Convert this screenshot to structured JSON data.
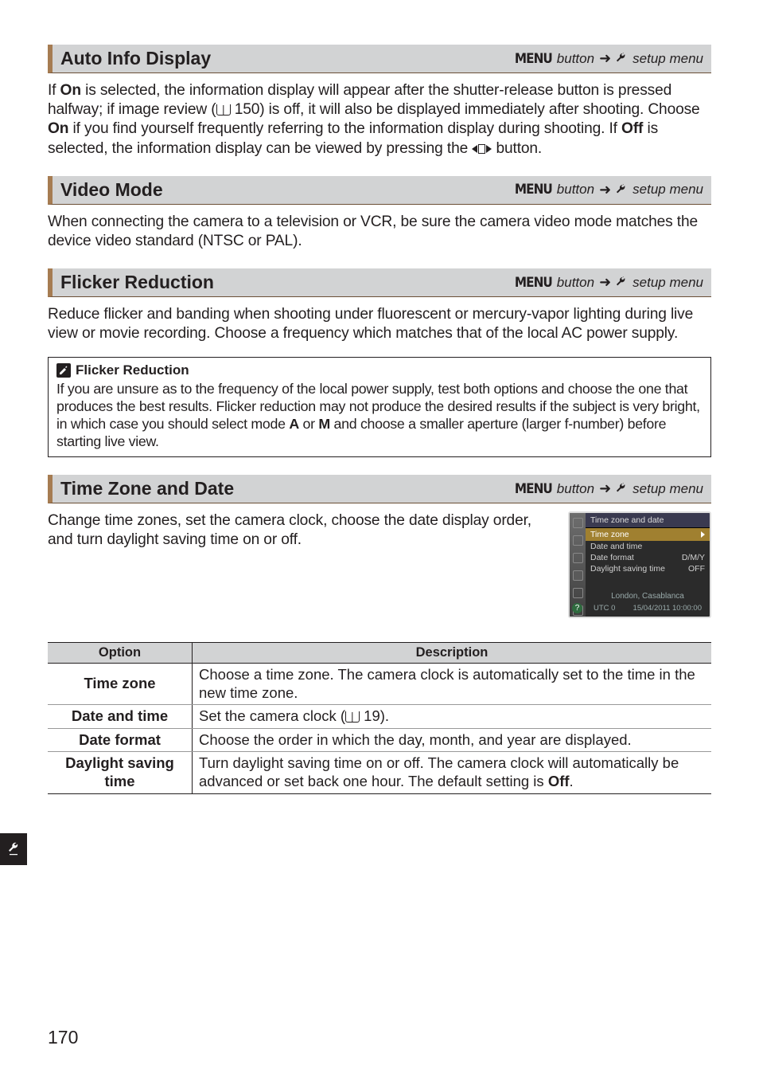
{
  "menu_button_label": "MENU",
  "menu_button_suffix": "button",
  "setup_menu_label": "setup menu",
  "sections": {
    "auto_info": {
      "title": "Auto Info Display",
      "body_pre": "If ",
      "body_on": "On",
      "body_mid1": " is selected, the information display will appear after the shutter-release button is pressed halfway; if image review (",
      "page_ref1": " 150) is off, it will also be displayed immediately after shooting.  Choose ",
      "body_on2": "On",
      "body_mid2": " if you find yourself frequently referring to the information display during shooting.  If ",
      "body_off": "Off",
      "body_mid3": " is selected, the information display can be viewed by pressing the ",
      "body_end": " button."
    },
    "video_mode": {
      "title": "Video Mode",
      "body": "When connecting the camera to a television or VCR, be sure the camera video mode matches the device video standard (NTSC or PAL)."
    },
    "flicker": {
      "title": "Flicker Reduction",
      "body": "Reduce flicker and banding when shooting under fluorescent or mercury-vapor lighting during live view or movie recording.  Choose a frequency which matches that of the local AC power supply.",
      "note_title": "Flicker Reduction",
      "note_body_pre": "If you are unsure as to the frequency of the local power supply, test both options and choose the one that produces the best results.  Flicker reduction may not produce the desired results if the subject is very bright, in which case you should select mode ",
      "note_mode_a": "A",
      "note_mid": " or ",
      "note_mode_m": "M",
      "note_body_post": " and choose a smaller aperture (larger f-number) before starting live view."
    },
    "timezone": {
      "title": "Time Zone and Date",
      "body": "Change time zones, set the camera clock, choose the date display order, and turn daylight saving time on or off."
    }
  },
  "tz_menu": {
    "header": "Time zone and date",
    "hl": "Time zone",
    "l1": "Date and time",
    "l2": "Date format",
    "l2_val": "D/M/Y",
    "l3": "Daylight saving time",
    "l3_val": "OFF",
    "footer1": "London, Casablanca",
    "footer2_left": "UTC 0",
    "footer2_right": "15/04/2011 10:00:00"
  },
  "table": {
    "head_option": "Option",
    "head_desc": "Description",
    "rows": [
      {
        "opt": "Time zone",
        "desc": "Choose a time zone.  The camera clock is automatically set to the time in the new time zone."
      },
      {
        "opt": "Date and time",
        "desc_pre": "Set the camera clock (",
        "desc_ref": " 19)."
      },
      {
        "opt": "Date format",
        "desc": "Choose the order in which the day, month, and year are displayed."
      },
      {
        "opt": "Daylight saving time",
        "desc_pre": "Turn daylight saving time on or off.  The camera clock will automatically be advanced or set back one hour.  The default setting is ",
        "desc_bold": "Off",
        "desc_post": "."
      }
    ]
  },
  "page_number": "170"
}
